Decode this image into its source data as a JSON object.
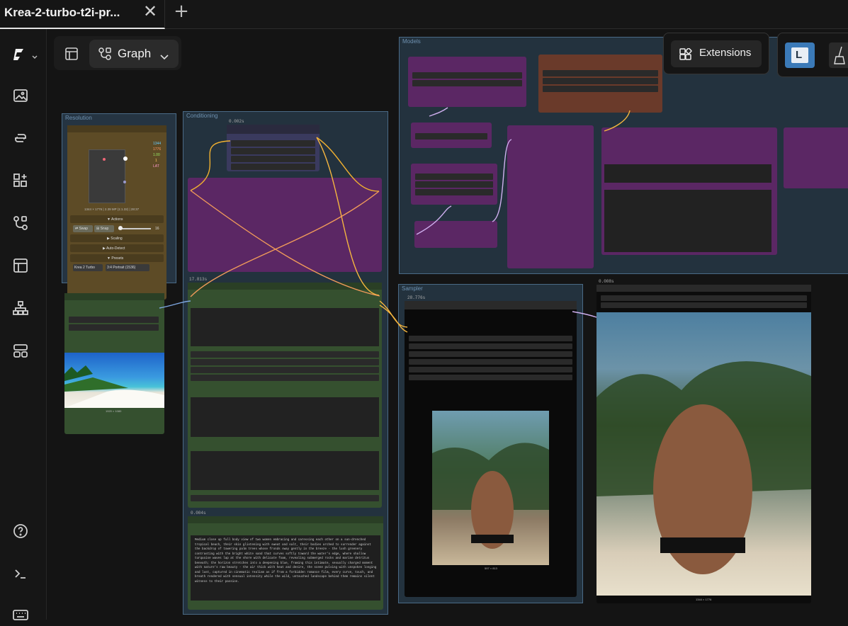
{
  "tab": {
    "title": "Krea-2-turbo-t2i-pr...",
    "close_glyph": "✕",
    "add_glyph": "+"
  },
  "toolbar": {
    "graph_label": "Graph",
    "extensions_label": "Extensions",
    "l_badge": "L"
  },
  "sidebar": {
    "items": [
      "logo-icon",
      "images-icon",
      "queue-icon",
      "nodes-icon",
      "workflow-icon",
      "templates-icon",
      "hierarchy-icon",
      "layout-icon",
      "help-icon",
      "terminal-icon",
      "keyboard-icon"
    ]
  },
  "groups": {
    "resolution": "Resolution",
    "conditioning": "Conditioning",
    "models": "Models",
    "sampler": "Sampler"
  },
  "timings": {
    "t1": "0.002s",
    "t2": "17.813s",
    "t3": "0.004s",
    "t4": "28.776s",
    "t5": "0.008s"
  },
  "resolution_node": {
    "values": [
      "1344",
      "1776",
      "1.00",
      "1",
      "LAT"
    ],
    "info": "1344 × 1776 | 2.39 MP (1:1.32) | 28:37",
    "actions": "▼ Actions",
    "swap": "⇄ Swap",
    "snap": "⊞ Snap",
    "snap_value": "16",
    "scaling": "▶ Scaling",
    "autodetect": "▶ Auto-Detect",
    "presets": "▼ Presets",
    "preset_model": "Krea 2 Turbo",
    "preset_size": "3:4 Portrait (1536)"
  },
  "image_sizes": {
    "input": "1920 × 1080",
    "preview": "597 × 813",
    "output": "1344 × 1776"
  },
  "prompt_text": "Medium close up full body view of two women embracing and caressing each other on a sun-drenched tropical beach, their skin glistening with sweat and salt, their bodies arched to surrender against the backdrop of towering palm trees whose fronds sway gently in the breeze - the lush greenery contrasting with the bright white sand that curves softly toward the water's edge, where shallow turquoise waves lap at the shore with delicate foam, revealing submerged rocks and marine detritus beneath; the horizon stretches into a deepening blue, framing this intimate, sexually charged moment with nature's raw beauty - the air thick with heat and desire, the scene pulsing with unspoken longing and lust, captured in cinematic realism as if from a forbidden romance film, every curve, touch, and breath rendered with sensual intensity while the wild, untouched landscape behind them remains silent witness to their passion.",
  "colors": {
    "resolution_group": "#5a4a2a",
    "conditioning_group": "#2f4b63",
    "purple_node": "#6b2e6b",
    "green_node": "#35502f",
    "brown_node": "#6a3a2a"
  }
}
